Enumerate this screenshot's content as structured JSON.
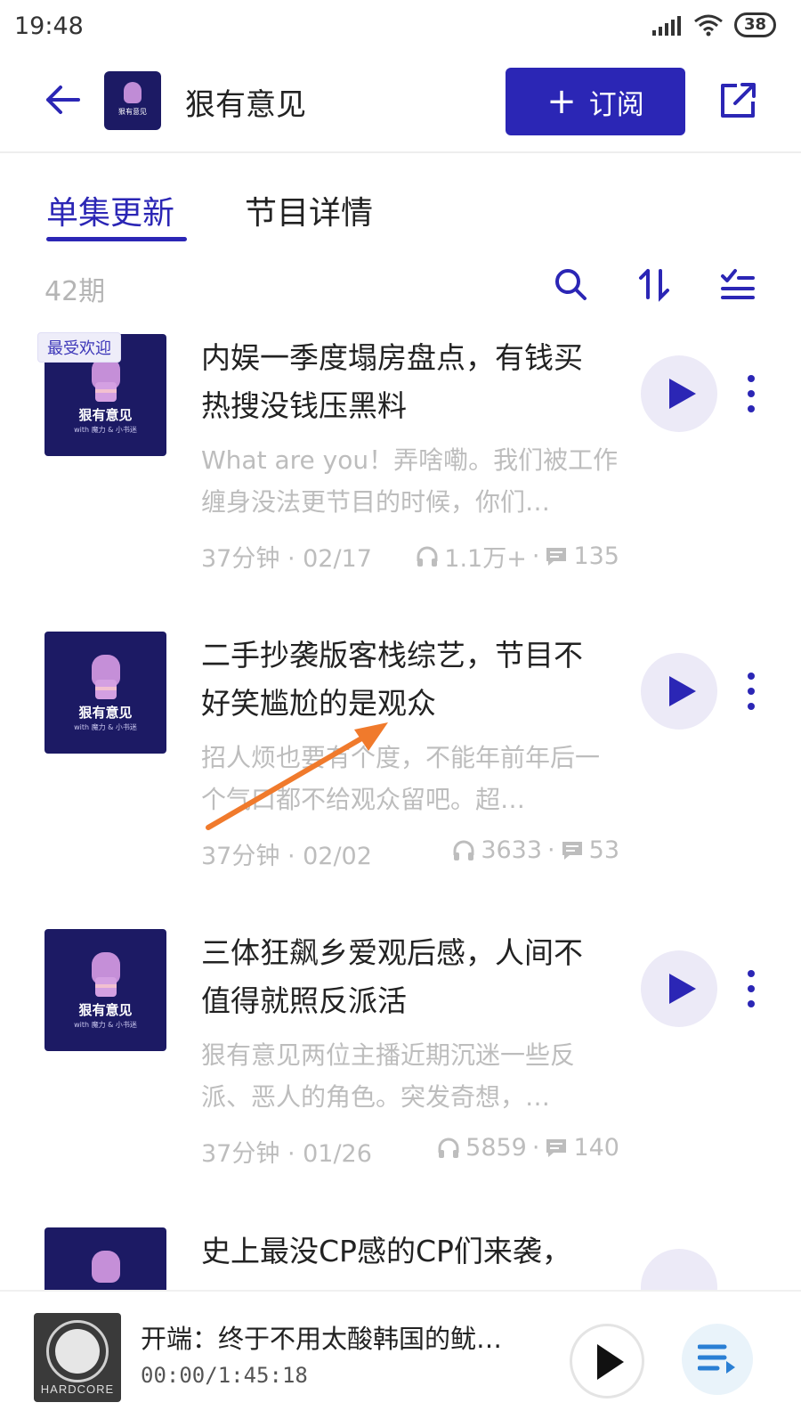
{
  "status_bar": {
    "time": "19:48",
    "battery": "38"
  },
  "header": {
    "podcast_title": "狠有意见",
    "subscribe_label": "订阅",
    "cover_text": "狠有意见"
  },
  "tabs": {
    "episodes": "单集更新",
    "details": "节目详情"
  },
  "toolbar": {
    "episode_count": "42期"
  },
  "episodes": [
    {
      "badge": "最受欢迎",
      "title": "内娱一季度塌房盘点，有钱买热搜没钱压黑料",
      "desc": "What are you！弄啥嘞。我们被工作缠身没法更节目的时候，你们…",
      "duration": "37分钟 · 02/17",
      "plays": "1.1万+",
      "comments": "135",
      "cover_name": "狠有意见",
      "cover_sub": "with 魔力 & 小书迷"
    },
    {
      "badge": "",
      "title": "二手抄袭版客栈综艺，节目不好笑尴尬的是观众",
      "desc": "招人烦也要有个度，不能年前年后一个气口都不给观众留吧。超…",
      "duration": "37分钟 · 02/02",
      "plays": "3633",
      "comments": "53",
      "cover_name": "狠有意见",
      "cover_sub": "with 魔力 & 小书迷"
    },
    {
      "badge": "",
      "title": "三体狂飙乡爱观后感，人间不值得就照反派活",
      "desc": "狠有意见两位主播近期沉迷一些反派、恶人的角色。突发奇想，…",
      "duration": "37分钟 · 01/26",
      "plays": "5859",
      "comments": "140",
      "cover_name": "狠有意见",
      "cover_sub": "with 魔力 & 小书迷"
    },
    {
      "badge": "",
      "title": "史上最没CP感的CP们来袭，",
      "desc": "",
      "duration": "",
      "plays": "",
      "comments": "",
      "cover_name": "",
      "cover_sub": ""
    }
  ],
  "player": {
    "title": "开端：终于不用太酸韩国的鱿…",
    "time": "00:00/1:45:18",
    "cover_text": "HARDCORE"
  },
  "colors": {
    "accent": "#2b26b5",
    "cover_bg": "#1c1a64",
    "muted": "#bdbdbd",
    "annotation": "#f07a2c"
  }
}
